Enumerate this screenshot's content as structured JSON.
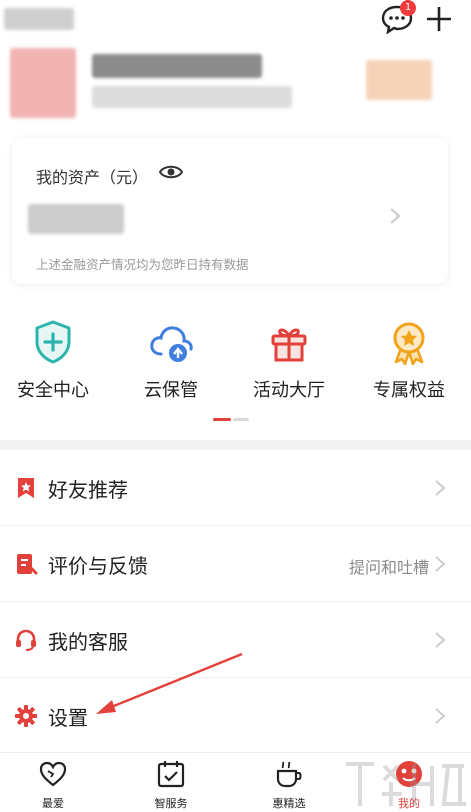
{
  "header": {
    "message_badge_count": "1"
  },
  "assets": {
    "title": "我的资产（元）",
    "note": "上述金融资产情况均为您昨日持有数据"
  },
  "quick_actions": [
    {
      "label": "安全中心",
      "icon": "shield-plus-icon",
      "color": "#2bb5ad"
    },
    {
      "label": "云保管",
      "icon": "cloud-upload-icon",
      "color": "#3f7fe0"
    },
    {
      "label": "活动大厅",
      "icon": "gift-icon",
      "color": "#e2403b"
    },
    {
      "label": "专属权益",
      "icon": "medal-icon",
      "color": "#f2a31b"
    }
  ],
  "menu": [
    {
      "label": "好友推荐",
      "icon": "bookmark-star-icon",
      "extra": ""
    },
    {
      "label": "评价与反馈",
      "icon": "feedback-icon",
      "extra": "提问和吐槽"
    },
    {
      "label": "我的客服",
      "icon": "headset-icon",
      "extra": ""
    },
    {
      "label": "设置",
      "icon": "gear-icon",
      "extra": ""
    }
  ],
  "tabs": [
    {
      "label": "最爱",
      "icon": "heart-icon"
    },
    {
      "label": "智服务",
      "icon": "calendar-check-icon"
    },
    {
      "label": "惠精选",
      "icon": "coffee-cup-icon"
    },
    {
      "label": "我的",
      "icon": "me-icon"
    }
  ],
  "colors": {
    "accent": "#e2403b",
    "divider": "#efefef",
    "muted_text": "#9a9a9a"
  }
}
